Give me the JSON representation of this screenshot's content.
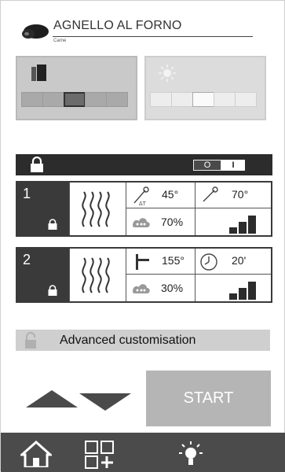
{
  "header": {
    "title": "AGNELLO AL FORNO",
    "subtitle": "Carne"
  },
  "mode_panels": [
    {
      "name": "cooking-mode",
      "segments": 5,
      "active_index": 2
    },
    {
      "name": "light-mode",
      "segments": 5,
      "active_index": 2
    }
  ],
  "lock_bar": {
    "toggle_off": "O",
    "toggle_on": "I"
  },
  "phases": [
    {
      "number": "1",
      "cell_a_value": "45°",
      "cell_a_icon": "probe-delta-t-icon",
      "cell_b_value": "70°",
      "cell_b_icon": "core-probe-icon",
      "humidity": "70%",
      "fan_level": 3
    },
    {
      "number": "2",
      "cell_a_value": "155°",
      "cell_a_icon": "thermometer-icon",
      "cell_b_value": "20'",
      "cell_b_icon": "clock-icon",
      "humidity": "30%",
      "fan_level": 3
    }
  ],
  "advanced": {
    "label": "Advanced customisation"
  },
  "start_button": {
    "label": "START"
  },
  "nav": [
    "home-icon",
    "programs-grid-icon",
    "light-bulb-icon"
  ],
  "colors": {
    "dark": "#2c2c2c",
    "panel_gray": "#c9c9c9",
    "start_gray": "#b5b5b5",
    "nav_bg": "#4b4b4b"
  }
}
